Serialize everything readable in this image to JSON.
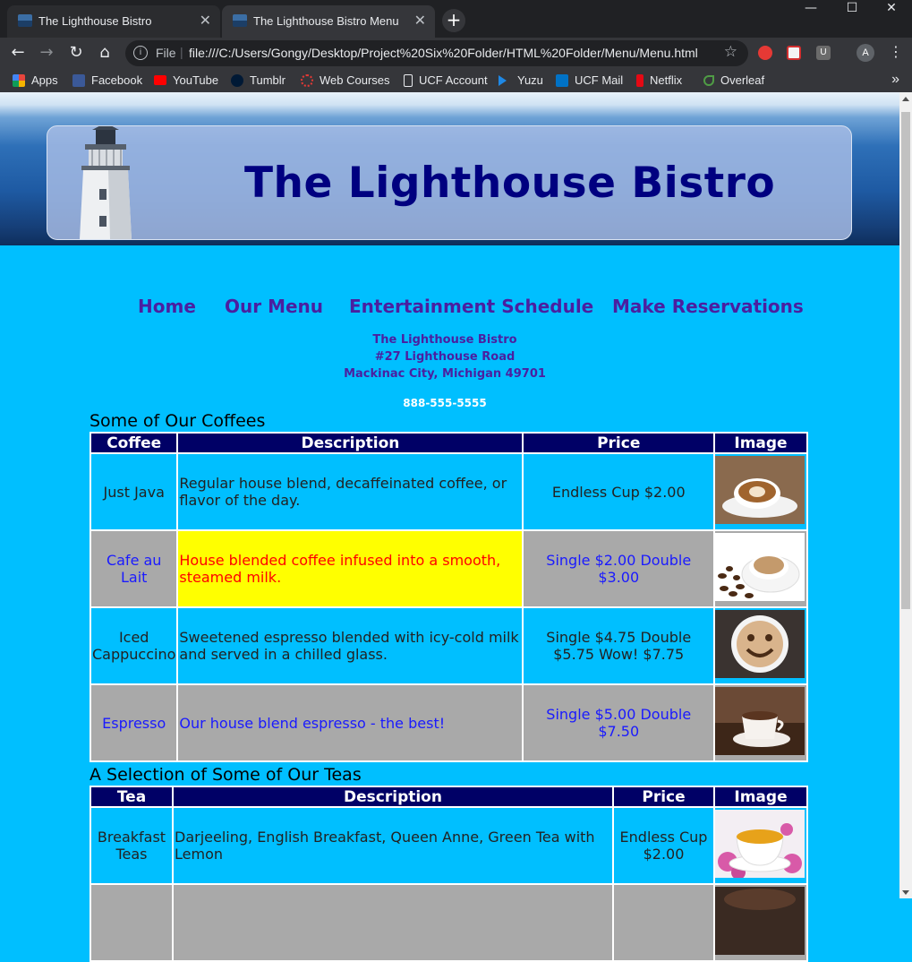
{
  "browser": {
    "tabs": [
      {
        "title": "The Lighthouse Bistro",
        "active": false
      },
      {
        "title": "The Lighthouse Bistro Menu",
        "active": true
      }
    ],
    "new_tab": "+",
    "window_controls": {
      "minimize": "—",
      "maximize": "☐",
      "close": "✕"
    },
    "address": {
      "scheme": "File",
      "separator": "|",
      "url": "file:///C:/Users/Gongy/Desktop/Project%20Six%20Folder/HTML%20Folder/Menu/Menu.html"
    },
    "profile_initial": "A",
    "bookmarks": [
      {
        "label": "Apps",
        "icon": "apps-grid-icon",
        "color": "#e8453c"
      },
      {
        "label": "Facebook",
        "icon": "facebook-icon",
        "color": "#3b5998"
      },
      {
        "label": "YouTube",
        "icon": "youtube-icon",
        "color": "#ff0000"
      },
      {
        "label": "Tumblr",
        "icon": "tumblr-icon",
        "color": "#001935"
      },
      {
        "label": "Web Courses",
        "icon": "webcourses-icon",
        "color": "#e53935"
      },
      {
        "label": "UCF Account",
        "icon": "page-icon",
        "color": "#e8eaed"
      },
      {
        "label": "Yuzu",
        "icon": "yuzu-icon",
        "color": "#1e88e5"
      },
      {
        "label": "UCF Mail",
        "icon": "outlook-icon",
        "color": "#0072c6"
      },
      {
        "label": "Netflix",
        "icon": "netflix-icon",
        "color": "#e50914"
      },
      {
        "label": "Overleaf",
        "icon": "overleaf-icon",
        "color": "#4f9c45"
      }
    ]
  },
  "site": {
    "title": "The Lighthouse Bistro",
    "nav": [
      "Home",
      "Our Menu",
      "Entertainment Schedule",
      "Make Reservations"
    ],
    "address": {
      "name": "The Lighthouse Bistro",
      "street": "#27 Lighthouse Road",
      "city": "Mackinac City, Michigan 49701",
      "phone": "888-555-5555"
    }
  },
  "coffees": {
    "caption": "Some of Our Coffees",
    "headers": [
      "Coffee",
      "Description",
      "Price",
      "Image"
    ],
    "rows": [
      {
        "name": "Just Java",
        "description": "Regular house blend, decaffeinated coffee, or flavor of the day.",
        "price": "Endless Cup $2.00",
        "image": "latte-art-cup"
      },
      {
        "name": "Cafe au Lait",
        "description": "House blended coffee infused into a smooth, steamed milk.",
        "price": "Single $2.00   Double $3.00",
        "image": "coffee-beans-cup"
      },
      {
        "name": "Iced Cappuccino",
        "description": "Sweetened espresso blended with icy-cold milk and served in a chilled glass.",
        "price": "Single $4.75   Double $5.75   Wow! $7.75",
        "image": "smiley-foam-cup"
      },
      {
        "name": "Espresso",
        "description": "Our house blend espresso - the best!",
        "price": "Single $5.00   Double $7.50",
        "image": "espresso-cup"
      }
    ]
  },
  "teas": {
    "caption": "A Selection of Some of Our Teas",
    "headers": [
      "Tea",
      "Description",
      "Price",
      "Image"
    ],
    "rows": [
      {
        "name": "Breakfast Teas",
        "description": "Darjeeling, English Breakfast, Queen Anne, Green Tea with Lemon",
        "price": "Endless Cup $2.00",
        "image": "tea-cup-flowers"
      }
    ]
  },
  "colors": {
    "page_bg": "#00bfff",
    "header_bg": "#000066",
    "nav_text": "#4b1fa0",
    "title_text": "#000080",
    "alt_row_bg": "#a9a9a9",
    "highlight_bg": "#ffff00",
    "highlight_text": "#ff0000"
  }
}
